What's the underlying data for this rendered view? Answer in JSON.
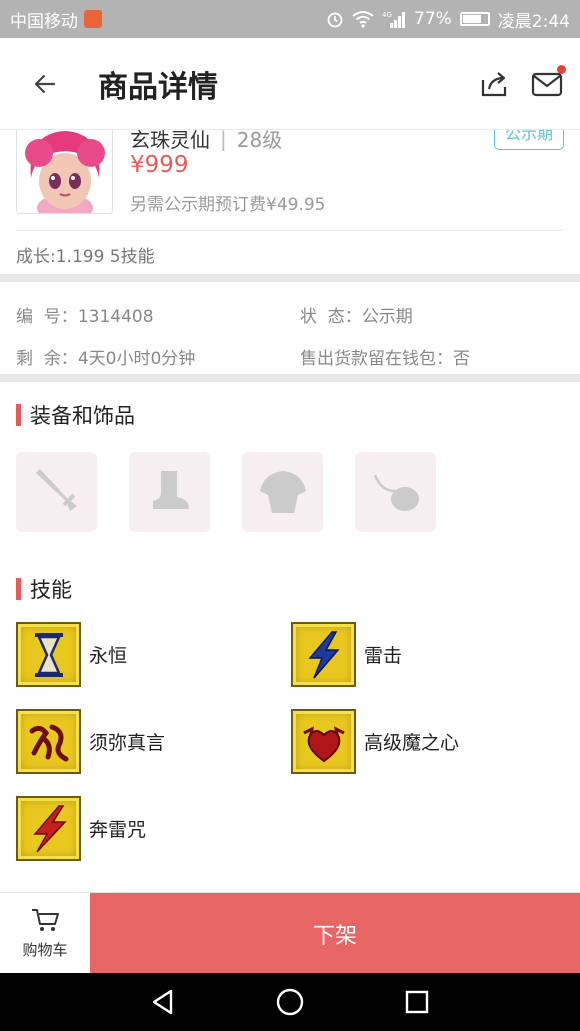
{
  "status_bar": {
    "carrier": "中国移动",
    "network": "4G",
    "battery": "77%",
    "battery_level": 0.77,
    "time": "凌晨2:44"
  },
  "header": {
    "title": "商品详情"
  },
  "product": {
    "name": "玄珠灵仙",
    "level": "28级",
    "status_tag": "公示期",
    "price": "¥999",
    "extra_fee": "另需公示期预订费¥49.95",
    "growth": "成长:1.199 5技能"
  },
  "info": {
    "id_label": "编  号：",
    "id_value": "1314408",
    "state_label": "状  态：",
    "state_value": "公示期",
    "remaining_label": "剩  余：",
    "remaining_value": "4天0小时0分钟",
    "wallet_label": "售出货款留在钱包：",
    "wallet_value": "否"
  },
  "equipment": {
    "title": "装备和饰品",
    "slots": [
      "sword",
      "boot",
      "armor",
      "accessory"
    ]
  },
  "skills": {
    "title": "技能",
    "items": [
      {
        "name": "永恒",
        "icon": "hourglass-icon"
      },
      {
        "name": "雷击",
        "icon": "lightning-icon"
      },
      {
        "name": "须弥真言",
        "icon": "rune-icon"
      },
      {
        "name": "高级魔之心",
        "icon": "heart-icon"
      },
      {
        "name": "奔雷咒",
        "icon": "red-lightning-icon"
      }
    ]
  },
  "bottom_bar": {
    "cart_label": "购物车",
    "delist_label": "下架"
  },
  "colors": {
    "accent": "#e86565",
    "price": "#e85a5a",
    "tag": "#5bc2d8"
  }
}
